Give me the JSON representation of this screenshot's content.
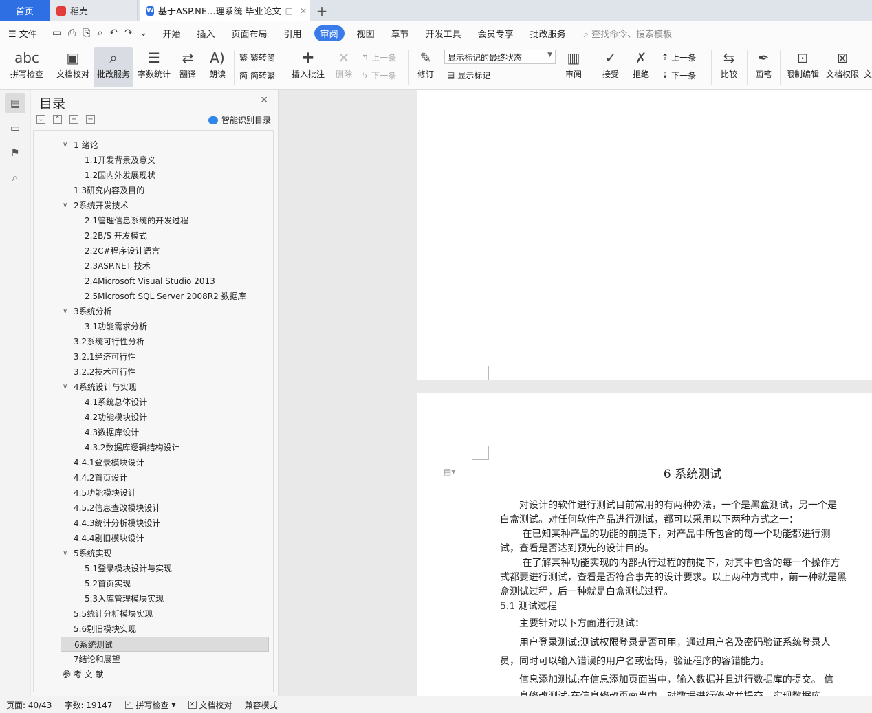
{
  "tabs": {
    "home": "首页",
    "docer": "稻壳",
    "document": "基于ASP.NE...理系统 毕业论文",
    "add": "+"
  },
  "menu": {
    "file": "文件",
    "items": [
      "开始",
      "插入",
      "页面布局",
      "引用",
      "审阅",
      "视图",
      "章节",
      "开发工具",
      "会员专享",
      "批改服务"
    ],
    "active": "审阅",
    "search": "查找命令、搜索模板"
  },
  "ribbon": {
    "spellcheck": "拼写检查",
    "proofread": "文档校对",
    "grading": "批改服务",
    "wordcount": "字数统计",
    "translate": "翻译",
    "read": "朗读",
    "to_traditional": "繁转简",
    "to_simplified": "简转繁",
    "insert_comment": "插入批注",
    "delete": "删除",
    "prev": "上一条",
    "next": "下一条",
    "track": "修订",
    "markup_state": "显示标记的最终状态",
    "show_markup": "显示标记",
    "review": "审阅",
    "accept": "接受",
    "reject": "拒绝",
    "prev2": "上一条",
    "next2": "下一条",
    "compare": "比较",
    "pen": "画笔",
    "restrict": "限制编辑",
    "permission": "文档权限",
    "cut_label": "文"
  },
  "toc": {
    "title": "目录",
    "smart": "智能识别目录",
    "items": [
      {
        "text": "1 绪论",
        "level": 0,
        "chev": true
      },
      {
        "text": "1.1开发背景及意义",
        "level": 1
      },
      {
        "text": "1.2国内外发展现状",
        "level": 1
      },
      {
        "text": "1.3研究内容及目的",
        "level": 0
      },
      {
        "text": "2系统开发技术",
        "level": 0,
        "chev": true
      },
      {
        "text": "2.1管理信息系统的开发过程",
        "level": 1
      },
      {
        "text": "2.2B/S 开发模式",
        "level": 1
      },
      {
        "text": "2.2C#程序设计语言",
        "level": 1
      },
      {
        "text": "2.3ASP.NET 技术",
        "level": 1
      },
      {
        "text": "2.4Microsoft Visual Studio 2013",
        "level": 1
      },
      {
        "text": "2.5Microsoft SQL Server 2008R2 数据库",
        "level": 1
      },
      {
        "text": "3系统分析",
        "level": 0,
        "chev": true
      },
      {
        "text": "3.1功能需求分析",
        "level": 1
      },
      {
        "text": "3.2系统可行性分析",
        "level": 0
      },
      {
        "text": "3.2.1经济可行性",
        "level": 0
      },
      {
        "text": "3.2.2技术可行性",
        "level": 0
      },
      {
        "text": "4系统设计与实现",
        "level": 0,
        "chev": true
      },
      {
        "text": "4.1系统总体设计",
        "level": 1
      },
      {
        "text": "4.2功能模块设计",
        "level": 1
      },
      {
        "text": "4.3数据库设计",
        "level": 1
      },
      {
        "text": "4.3.2数据库逻辑结构设计",
        "level": 1
      },
      {
        "text": "4.4.1登录模块设计",
        "level": 0
      },
      {
        "text": "4.4.2首页设计",
        "level": 0
      },
      {
        "text": "4.5功能模块设计",
        "level": 0
      },
      {
        "text": "4.5.2信息查改模块设计",
        "level": 0
      },
      {
        "text": "4.4.3统计分析模块设计",
        "level": 0
      },
      {
        "text": "4.4.4剔旧模块设计",
        "level": 0
      },
      {
        "text": "5系统实现",
        "level": 0,
        "chev": true
      },
      {
        "text": "5.1登录模块设计与实现",
        "level": 1
      },
      {
        "text": "5.2首页实现",
        "level": 1
      },
      {
        "text": "5.3入库管理模块实现",
        "level": 1
      },
      {
        "text": "5.5统计分析模块实现",
        "level": 0
      },
      {
        "text": "5.6剔旧模块实现",
        "level": 0
      },
      {
        "text": "6系统测试",
        "level": 0,
        "selected": true
      },
      {
        "text": "7结论和展望",
        "level": 0
      },
      {
        "text": "参 考 文 献",
        "level": -1
      }
    ]
  },
  "document": {
    "heading": "6  系统测试",
    "lines": [
      "　　对设计的软件进行测试目前常用的有两种办法，一个是黑盒测试，另一个是",
      "白盒测试。对任何软件产品进行测试，都可以采用以下两种方式之一：",
      "　　 在已知某种产品的功能的前提下，对产品中所包含的每一个功能都进行测",
      "试，查看是否达到预先的设计目的。",
      "　　 在了解某种功能实现的内部执行过程的前提下，对其中包含的每一个操作方",
      "式都要进行测试，查看是否符合事先的设计要求。以上两种方式中，前一种就是黑",
      "盒测试过程，后一种就是白盒测试过程。",
      "5.1 测试过程",
      "　　主要针对以下方面进行测试：",
      "　　用户登录测试:测试权限登录是否可用，通过用户名及密码验证系统登录人",
      "员，同时可以输入错误的用户名或密码，验证程序的容错能力。",
      "　　信息添加测试:在信息添加页面当中，输入数据并且进行数据库的提交。 信",
      "　　息修改测试:在信息修改页面当中，对数据进行修改并提交，实现数据库"
    ]
  },
  "status": {
    "page": "页面: 40/43",
    "words": "字数: 19147",
    "spell": "拼写检查",
    "proof": "文档校对",
    "compat": "兼容模式"
  }
}
